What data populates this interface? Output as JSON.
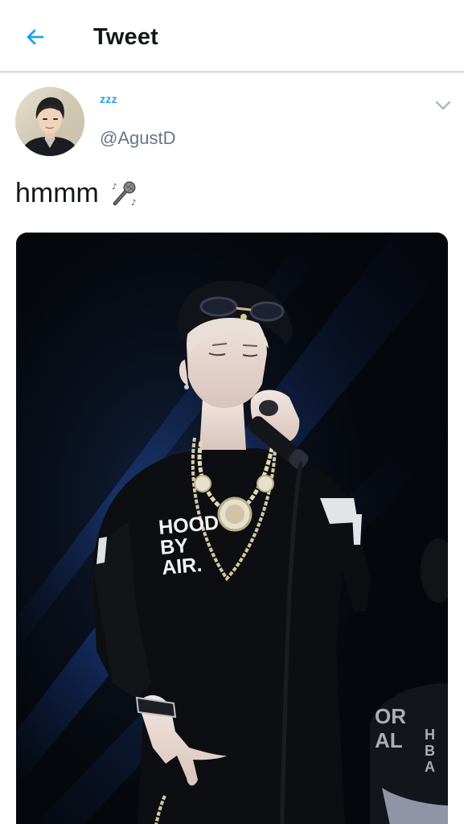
{
  "header": {
    "title": "Tweet",
    "back_icon": "arrow-left-icon",
    "accent_color": "#1da1f2"
  },
  "tweet": {
    "display_name": "ᶻᶻᶻ",
    "handle": "@AgustD",
    "text": "hmmm",
    "emoji_icon": "microphone-icon",
    "menu_icon": "chevron-down-icon",
    "media": {
      "shirt_text_lines": [
        "HOOD",
        "BY",
        "AIR."
      ]
    }
  }
}
